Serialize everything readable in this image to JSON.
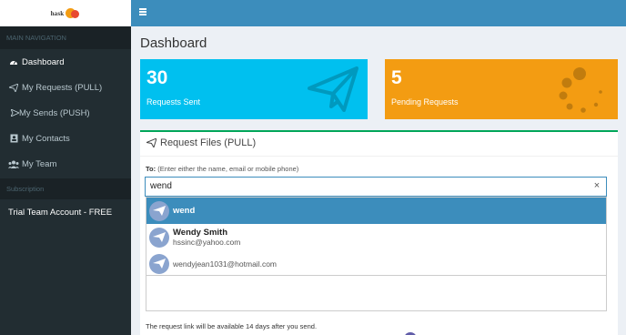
{
  "logo": {
    "text": "hask"
  },
  "sidebar": {
    "header": "MAIN NAVIGATION",
    "items": [
      {
        "label": "Dashboard",
        "icon": "dashboard-icon",
        "active": true
      },
      {
        "label": "My Requests (PULL)",
        "icon": "paper-plane-icon"
      },
      {
        "label": "My Sends (PUSH)",
        "icon": "send-icon"
      },
      {
        "label": "My Contacts",
        "icon": "contacts-icon"
      },
      {
        "label": "My Team",
        "icon": "team-icon"
      }
    ],
    "subscription_header": "Subscription",
    "subscription_item": "Trial Team Account - FREE"
  },
  "header": {
    "title": "Dashboard"
  },
  "stats": {
    "sent": {
      "value": "30",
      "label": "Requests Sent",
      "color": "#00c0ef"
    },
    "pending": {
      "value": "5",
      "label": "Pending Requests",
      "color": "#f39c12"
    }
  },
  "panel": {
    "title": "Request Files (PULL)",
    "to_label": "To:",
    "to_hint": "(Enter either the name, email or mobile phone)",
    "search_value": "wend",
    "clear_symbol": "×",
    "suggestions": [
      {
        "name": "wend",
        "email": "",
        "selected": true
      },
      {
        "name": "Wendy Smith",
        "email": "hssinc@yahoo.com",
        "selected": false
      },
      {
        "name": "",
        "email": "wendyjean1031@hotmail.com",
        "selected": false
      }
    ],
    "note": "The request link will be available 14 days after you send."
  },
  "colors": {
    "topbar": "#3c8dbc",
    "sidebar": "#222d32",
    "panel_border": "#00a65a",
    "selection": "#3c8dbc"
  }
}
